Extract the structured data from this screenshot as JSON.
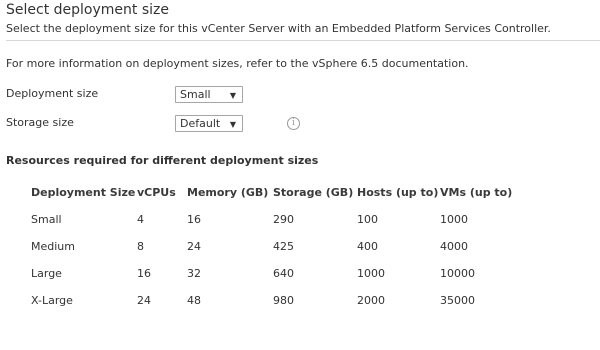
{
  "header": {
    "title": "Select deployment size",
    "subtitle": "Select the deployment size for this vCenter Server with an Embedded Platform Services Controller."
  },
  "info_text": "For more information on deployment sizes, refer to the vSphere 6.5 documentation.",
  "deployment_size": {
    "label": "Deployment size",
    "value": "Small"
  },
  "storage_size": {
    "label": "Storage size",
    "value": "Default"
  },
  "info_icon": "i",
  "resources": {
    "heading": "Resources required for different deployment sizes",
    "columns": [
      "Deployment Size",
      "vCPUs",
      "Memory (GB)",
      "Storage (GB)",
      "Hosts (up to)",
      "VMs (up to)"
    ],
    "rows": [
      [
        "Small",
        "4",
        "16",
        "290",
        "100",
        "1000"
      ],
      [
        "Medium",
        "8",
        "24",
        "425",
        "400",
        "4000"
      ],
      [
        "Large",
        "16",
        "32",
        "640",
        "1000",
        "10000"
      ],
      [
        "X-Large",
        "24",
        "48",
        "980",
        "2000",
        "35000"
      ]
    ]
  }
}
